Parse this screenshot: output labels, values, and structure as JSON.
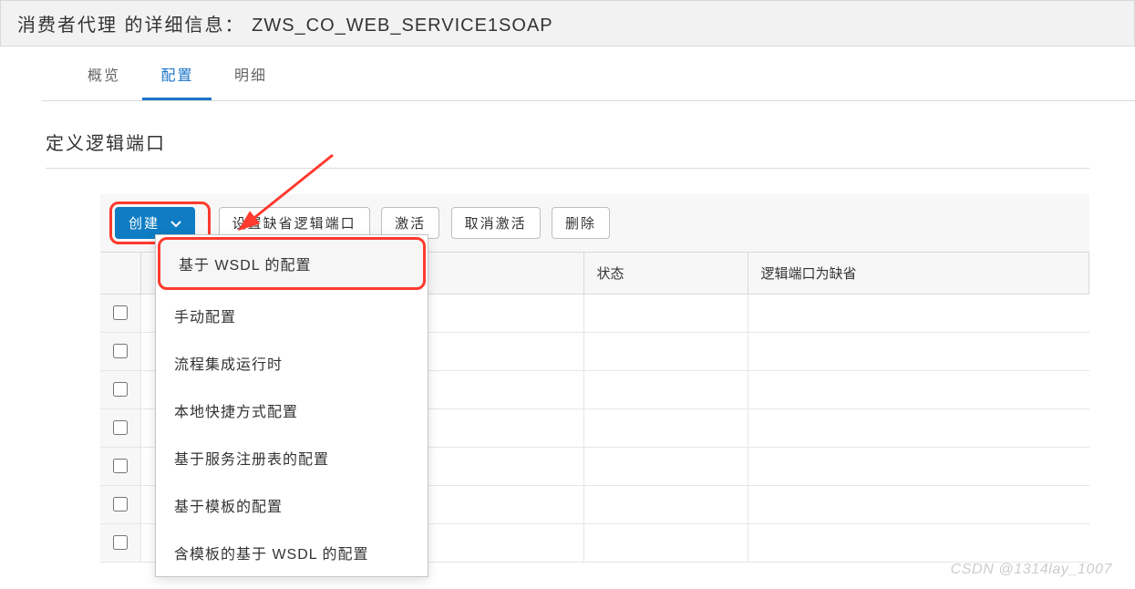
{
  "header": {
    "prefix": "消费者代理 的详细信息：",
    "name": "ZWS_CO_WEB_SERVICE1SOAP"
  },
  "tabs": {
    "items": [
      {
        "label": "概览",
        "active": false
      },
      {
        "label": "配置",
        "active": true
      },
      {
        "label": "明细",
        "active": false
      }
    ]
  },
  "section": {
    "title": "定义逻辑端口"
  },
  "toolbar": {
    "create_label": "创建",
    "set_default_label": "设置缺省逻辑端口",
    "activate_label": "激活",
    "deactivate_label": "取消激活",
    "delete_label": "删除"
  },
  "dropdown": {
    "items": [
      "基于 WSDL 的配置",
      "手动配置",
      "流程集成运行时",
      "本地快捷方式配置",
      "基于服务注册表的配置",
      "基于模板的配置",
      "含模板的基于 WSDL 的配置"
    ]
  },
  "table": {
    "columns": {
      "c2": "状态",
      "c3": "逻辑端口为缺省"
    },
    "row_count": 7
  },
  "watermark": "CSDN @1314lay_1007"
}
